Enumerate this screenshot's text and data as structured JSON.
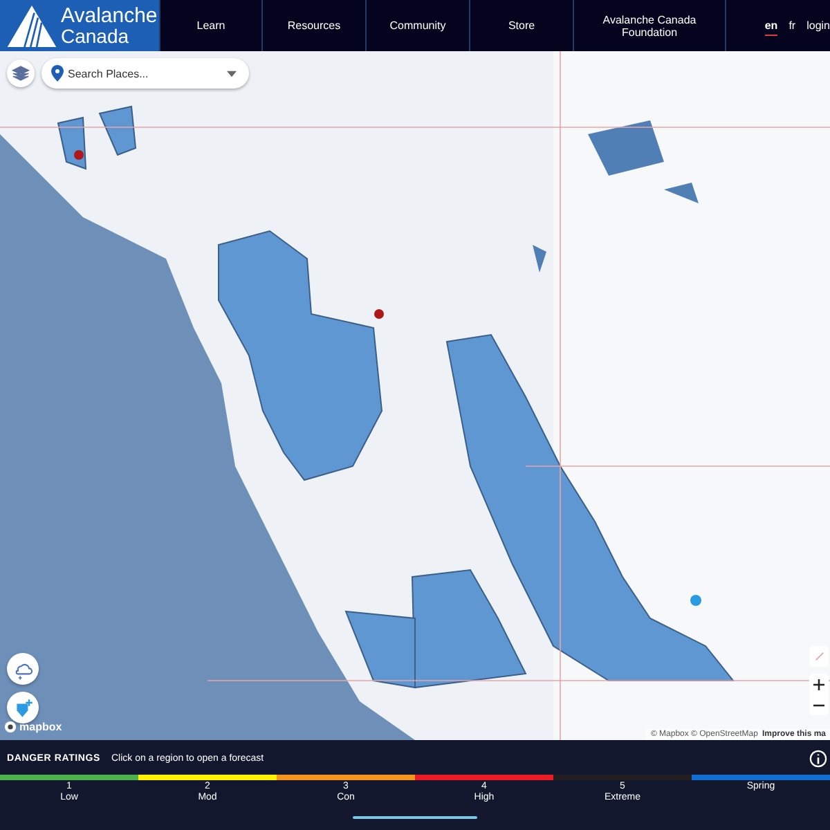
{
  "header": {
    "logo": {
      "line_1": "Avalanche",
      "line_2": "Canada"
    },
    "nav": [
      "Learn",
      "Resources",
      "Community",
      "Store",
      "Avalanche Canada Foundation"
    ],
    "languages": [
      {
        "label": "en",
        "selected": true
      },
      {
        "label": "fr",
        "selected": false
      }
    ],
    "login": "login"
  },
  "map": {
    "search": {
      "placeholder": "Search Places..."
    },
    "logo": "mapbox",
    "attribution": "© Mapbox © OpenStreetMap",
    "improve_link": "Improve this ma"
  },
  "danger_ratings": {
    "title": "DANGER RATINGS",
    "hint": "Click on a region to open a forecast",
    "levels": [
      {
        "number": "1",
        "label": "Low",
        "color": "#4db24a"
      },
      {
        "number": "2",
        "label": "Mod",
        "color": "#fff200"
      },
      {
        "number": "3",
        "label": "Con",
        "color": "#f7941e"
      },
      {
        "number": "4",
        "label": "High",
        "color": "#ed1c24"
      },
      {
        "number": "5",
        "label": "Extreme",
        "color": "#231f20"
      },
      {
        "label": "Spring",
        "color": "#0f6fd2"
      }
    ]
  }
}
